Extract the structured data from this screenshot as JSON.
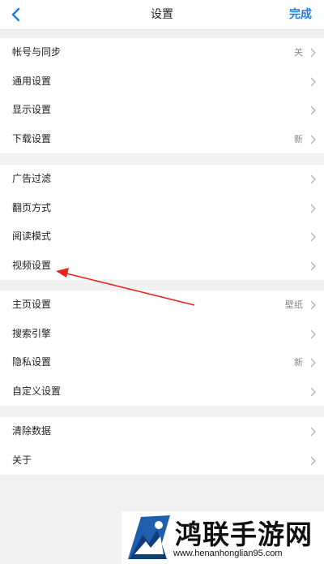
{
  "header": {
    "title": "设置",
    "done_label": "完成",
    "back_icon": "chevron-left-icon",
    "accent_color": "#1a7fe6"
  },
  "groups": [
    {
      "rows": [
        {
          "label": "帐号与同步",
          "value": "关"
        },
        {
          "label": "通用设置",
          "value": ""
        },
        {
          "label": "显示设置",
          "value": ""
        },
        {
          "label": "下载设置",
          "value": "新"
        }
      ]
    },
    {
      "rows": [
        {
          "label": "广告过滤",
          "value": ""
        },
        {
          "label": "翻页方式",
          "value": ""
        },
        {
          "label": "阅读模式",
          "value": ""
        },
        {
          "label": "视频设置",
          "value": ""
        }
      ]
    },
    {
      "rows": [
        {
          "label": "主页设置",
          "value": "壁纸"
        },
        {
          "label": "搜索引擎",
          "value": ""
        },
        {
          "label": "隐私设置",
          "value": "新"
        },
        {
          "label": "自定义设置",
          "value": ""
        }
      ]
    },
    {
      "rows": [
        {
          "label": "清除数据",
          "value": ""
        },
        {
          "label": "关于",
          "value": ""
        }
      ]
    }
  ],
  "annotation": {
    "arrow_color": "#e8231f",
    "points_to": "视频设置"
  },
  "watermark": {
    "name": "鸿联手游网",
    "domain": "www.henanhonglian95.com"
  }
}
